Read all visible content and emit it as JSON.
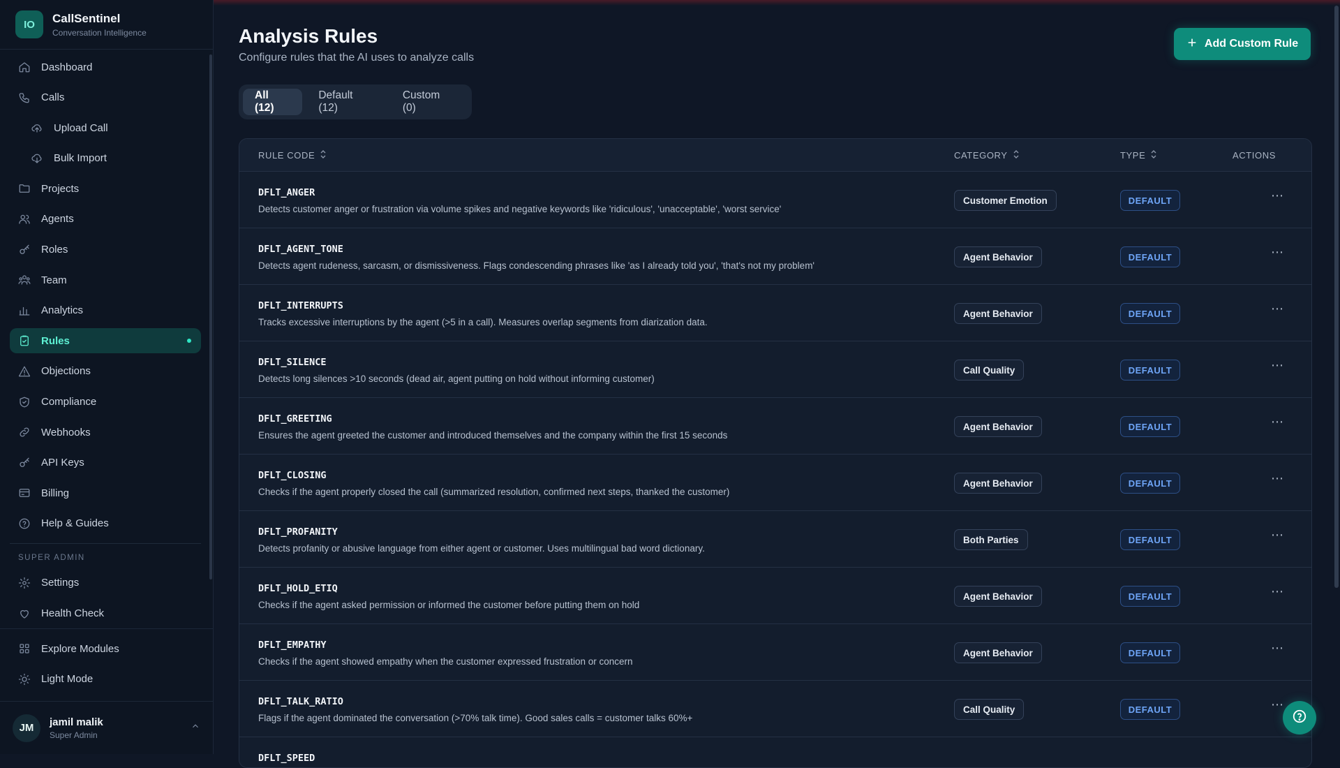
{
  "app": {
    "name": "CallSentinel",
    "tagline": "Conversation Intelligence",
    "logo_text": "IO"
  },
  "sidebar": {
    "items": [
      {
        "label": "Dashboard",
        "icon": "home-icon"
      },
      {
        "label": "Calls",
        "icon": "phone-icon"
      },
      {
        "label": "Upload Call",
        "icon": "upload-cloud-icon",
        "sub": true
      },
      {
        "label": "Bulk Import",
        "icon": "download-cloud-icon",
        "sub": true
      },
      {
        "label": "Projects",
        "icon": "folder-icon"
      },
      {
        "label": "Agents",
        "icon": "users-icon"
      },
      {
        "label": "Roles",
        "icon": "key-icon"
      },
      {
        "label": "Team",
        "icon": "team-icon"
      },
      {
        "label": "Analytics",
        "icon": "bar-chart-icon"
      },
      {
        "label": "Rules",
        "icon": "clipboard-check-icon",
        "active": true
      },
      {
        "label": "Objections",
        "icon": "warning-icon"
      },
      {
        "label": "Compliance",
        "icon": "shield-icon"
      },
      {
        "label": "Webhooks",
        "icon": "link-icon"
      },
      {
        "label": "API Keys",
        "icon": "key-icon"
      },
      {
        "label": "Billing",
        "icon": "credit-card-icon"
      },
      {
        "label": "Help & Guides",
        "icon": "help-circle-icon"
      }
    ],
    "section_label": "SUPER ADMIN",
    "admin_items": [
      {
        "label": "Settings",
        "icon": "gear-icon"
      },
      {
        "label": "Health Check",
        "icon": "heart-icon"
      }
    ],
    "bottom_items": [
      {
        "label": "Explore Modules",
        "icon": "grid-icon"
      },
      {
        "label": "Light Mode",
        "icon": "sun-icon"
      }
    ]
  },
  "user": {
    "initials": "JM",
    "name": "jamil malik",
    "role": "Super Admin"
  },
  "page": {
    "title": "Analysis Rules",
    "subtitle": "Configure rules that the AI uses to analyze calls",
    "add_button": "Add Custom Rule"
  },
  "tabs": [
    {
      "label": "All (12)",
      "active": true
    },
    {
      "label": "Default (12)"
    },
    {
      "label": "Custom (0)"
    }
  ],
  "table": {
    "columns": {
      "rule_code": "RULE CODE",
      "category": "CATEGORY",
      "type": "TYPE",
      "actions": "ACTIONS"
    },
    "rows": [
      {
        "code": "DFLT_ANGER",
        "desc": "Detects customer anger or frustration via volume spikes and negative keywords like 'ridiculous', 'unacceptable', 'worst service'",
        "category": "Customer Emotion",
        "type": "DEFAULT"
      },
      {
        "code": "DFLT_AGENT_TONE",
        "desc": "Detects agent rudeness, sarcasm, or dismissiveness. Flags condescending phrases like 'as I already told you', 'that's not my problem'",
        "category": "Agent Behavior",
        "type": "DEFAULT"
      },
      {
        "code": "DFLT_INTERRUPTS",
        "desc": "Tracks excessive interruptions by the agent (>5 in a call). Measures overlap segments from diarization data.",
        "category": "Agent Behavior",
        "type": "DEFAULT"
      },
      {
        "code": "DFLT_SILENCE",
        "desc": "Detects long silences >10 seconds (dead air, agent putting on hold without informing customer)",
        "category": "Call Quality",
        "type": "DEFAULT"
      },
      {
        "code": "DFLT_GREETING",
        "desc": "Ensures the agent greeted the customer and introduced themselves and the company within the first 15 seconds",
        "category": "Agent Behavior",
        "type": "DEFAULT"
      },
      {
        "code": "DFLT_CLOSING",
        "desc": "Checks if the agent properly closed the call (summarized resolution, confirmed next steps, thanked the customer)",
        "category": "Agent Behavior",
        "type": "DEFAULT"
      },
      {
        "code": "DFLT_PROFANITY",
        "desc": "Detects profanity or abusive language from either agent or customer. Uses multilingual bad word dictionary.",
        "category": "Both Parties",
        "type": "DEFAULT"
      },
      {
        "code": "DFLT_HOLD_ETIQ",
        "desc": "Checks if the agent asked permission or informed the customer before putting them on hold",
        "category": "Agent Behavior",
        "type": "DEFAULT"
      },
      {
        "code": "DFLT_EMPATHY",
        "desc": "Checks if the agent showed empathy when the customer expressed frustration or concern",
        "category": "Agent Behavior",
        "type": "DEFAULT"
      },
      {
        "code": "DFLT_TALK_RATIO",
        "desc": "Flags if the agent dominated the conversation (>70% talk time). Good sales calls = customer talks 60%+",
        "category": "Call Quality",
        "type": "DEFAULT"
      },
      {
        "code": "DFLT_SPEED",
        "desc": "",
        "category": "",
        "type": ""
      }
    ]
  }
}
